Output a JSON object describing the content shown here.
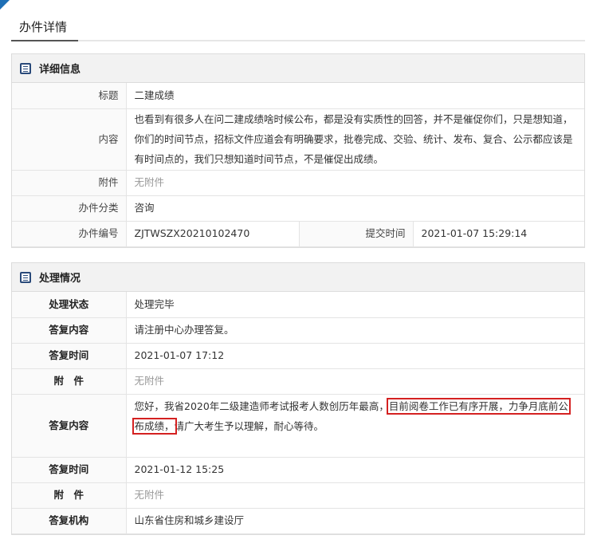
{
  "page": {
    "title": "办件详情"
  },
  "details": {
    "section_title": "详细信息",
    "title_label": "标题",
    "title_value": "二建成绩",
    "content_label": "内容",
    "content_value": "也看到有很多人在问二建成绩啥时候公布，都是没有实质性的回答，并不是催促你们，只是想知道，你们的时间节点，招标文件应道会有明确要求，批卷完成、交验、统计、发布、复合、公示都应该是有时间点的，我们只想知道时间节点，不是催促出成绩。",
    "attachment_label": "附件",
    "attachment_value": "无附件",
    "category_label": "办件分类",
    "category_value": "咨询",
    "number_label": "办件编号",
    "number_value": "ZJTWSZX20210102470",
    "submit_time_label": "提交时间",
    "submit_time_value": "2021-01-07 15:29:14"
  },
  "processing": {
    "section_title": "处理情况",
    "status_label": "处理状态",
    "status_value": "处理完毕",
    "reply1_label": "答复内容",
    "reply1_value": "请注册中心办理答复。",
    "time1_label": "答复时间",
    "time1_value": "2021-01-07 17:12",
    "attach1_label": "附　件",
    "attach1_value": "无附件",
    "reply2_label": "答复内容",
    "reply2_part1": "您好，我省2020年二级建造师考试报考人数创历年最高，",
    "reply2_highlight1": "目前阅卷工作已有序开展，力争月底前公",
    "reply2_highlight2": "布成绩",
    "reply2_comma": "，",
    "reply2_part2": "请广大考生予以理解，耐心等待。",
    "time2_label": "答复时间",
    "time2_value": "2021-01-12 15:25",
    "attach2_label": "附　件",
    "attach2_value": "无附件",
    "org_label": "答复机构",
    "org_value": "山东省住房和城乡建设厅"
  }
}
